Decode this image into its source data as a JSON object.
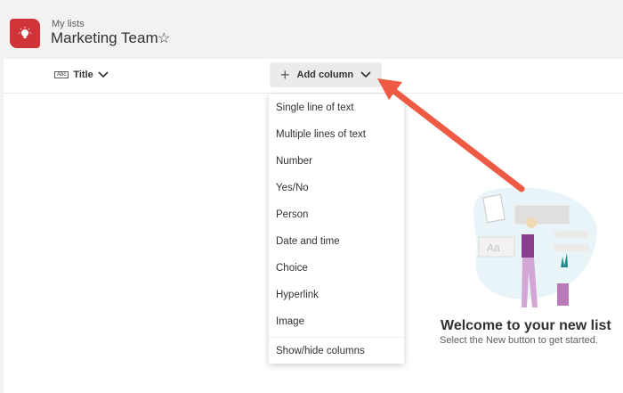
{
  "header": {
    "breadcrumb": "My lists",
    "title": "Marketing Team"
  },
  "columns": {
    "title_label": "Title",
    "title_icon_text": "Abc",
    "add_column_label": "Add column"
  },
  "menu": {
    "items": [
      "Single line of text",
      "Multiple lines of text",
      "Number",
      "Yes/No",
      "Person",
      "Date and time",
      "Choice",
      "Hyperlink",
      "Image"
    ],
    "footer": "Show/hide columns"
  },
  "empty_state": {
    "title": "Welcome to your new list",
    "subtitle": "Select the New button to get started.",
    "illustration_text": "Aa"
  },
  "colors": {
    "brand": "#d13438",
    "arrow": "#ef5a44"
  }
}
